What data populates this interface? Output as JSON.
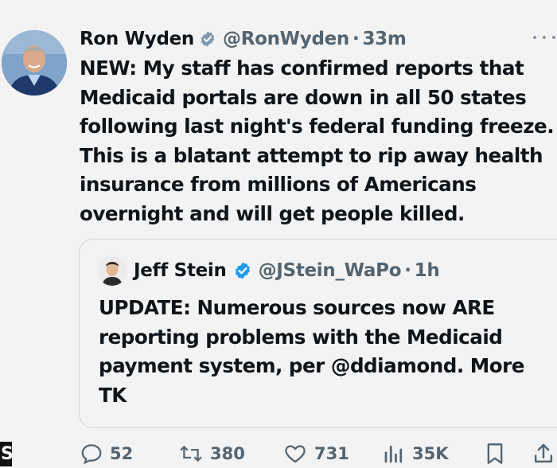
{
  "tweet": {
    "author_name": "Ron Wyden",
    "handle": "@RonWyden",
    "separator": "·",
    "time": "33m",
    "text": "NEW: My staff has confirmed reports that Medicaid portals are down in all 50 states following last night's federal funding freeze. This is a blatant attempt to rip away health insurance from millions of Americans overnight and will get people killed."
  },
  "quote": {
    "author_name": "Jeff Stein",
    "handle": "@JStein_WaPo",
    "separator": "·",
    "time": "1h",
    "text": "UPDATE: Numerous sources now ARE reporting problems with the Medicaid payment system, per @ddiamond. More TK"
  },
  "actions": {
    "replies": "52",
    "reposts": "380",
    "likes": "731",
    "views": "35K"
  },
  "edge_glyph": "S",
  "icons": {
    "author_verified": "gray-verified-badge-icon",
    "quote_verified": "blue-verified-badge-icon",
    "reply": "reply-icon",
    "repost": "repost-icon",
    "like": "heart-icon",
    "views": "views-chart-icon",
    "bookmark": "bookmark-icon",
    "share": "share-icon",
    "more": "more-options-icon"
  },
  "colors": {
    "text": "#0f1419",
    "secondary": "#536471",
    "verified_blue": "#1d9bf0",
    "verified_gray": "#829aab",
    "background": "#f3f3f3",
    "border": "#cfd9de"
  }
}
